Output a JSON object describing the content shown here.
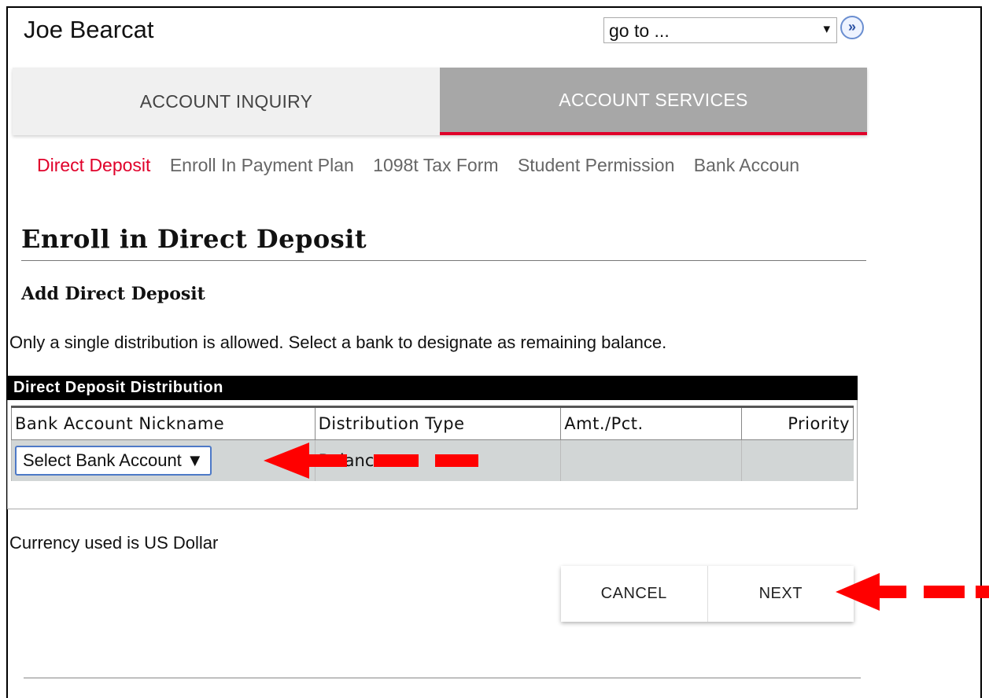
{
  "header": {
    "user_name": "Joe Bearcat",
    "goto": {
      "selected": "go to ...",
      "caret": "▾",
      "button_glyph": "»"
    }
  },
  "tabs": [
    {
      "label": "ACCOUNT INQUIRY",
      "active": false
    },
    {
      "label": "ACCOUNT SERVICES",
      "active": true
    }
  ],
  "subnav": [
    {
      "label": "Direct Deposit",
      "active": true
    },
    {
      "label": "Enroll In Payment Plan",
      "active": false
    },
    {
      "label": "1098t Tax Form",
      "active": false
    },
    {
      "label": "Student Permission",
      "active": false
    },
    {
      "label": "Bank Accoun",
      "active": false
    }
  ],
  "page": {
    "title": "Enroll in Direct Deposit",
    "section_title": "Add Direct Deposit",
    "instructions": "Only a single distribution is allowed. Select a bank to designate as remaining balance."
  },
  "distribution": {
    "header": "Direct Deposit Distribution",
    "columns": [
      "Bank Account Nickname",
      "Distribution Type",
      "Amt./Pct.",
      "Priority"
    ],
    "row": {
      "bank_select": "Select Bank Account ▼",
      "distribution_type": "Balance",
      "amount": "",
      "priority": ""
    }
  },
  "currency_note": "Currency used is US Dollar",
  "buttons": {
    "cancel": "CANCEL",
    "next": "NEXT"
  },
  "colors": {
    "accent_red": "#e0002a",
    "annotation_red": "#ff0000",
    "tab_active_bg": "#a7a7a7",
    "tab_inactive_bg": "#f0f0f0"
  },
  "icons": [
    "dropdown-caret-icon",
    "go-forward-icon",
    "annotation-arrow-icon"
  ]
}
